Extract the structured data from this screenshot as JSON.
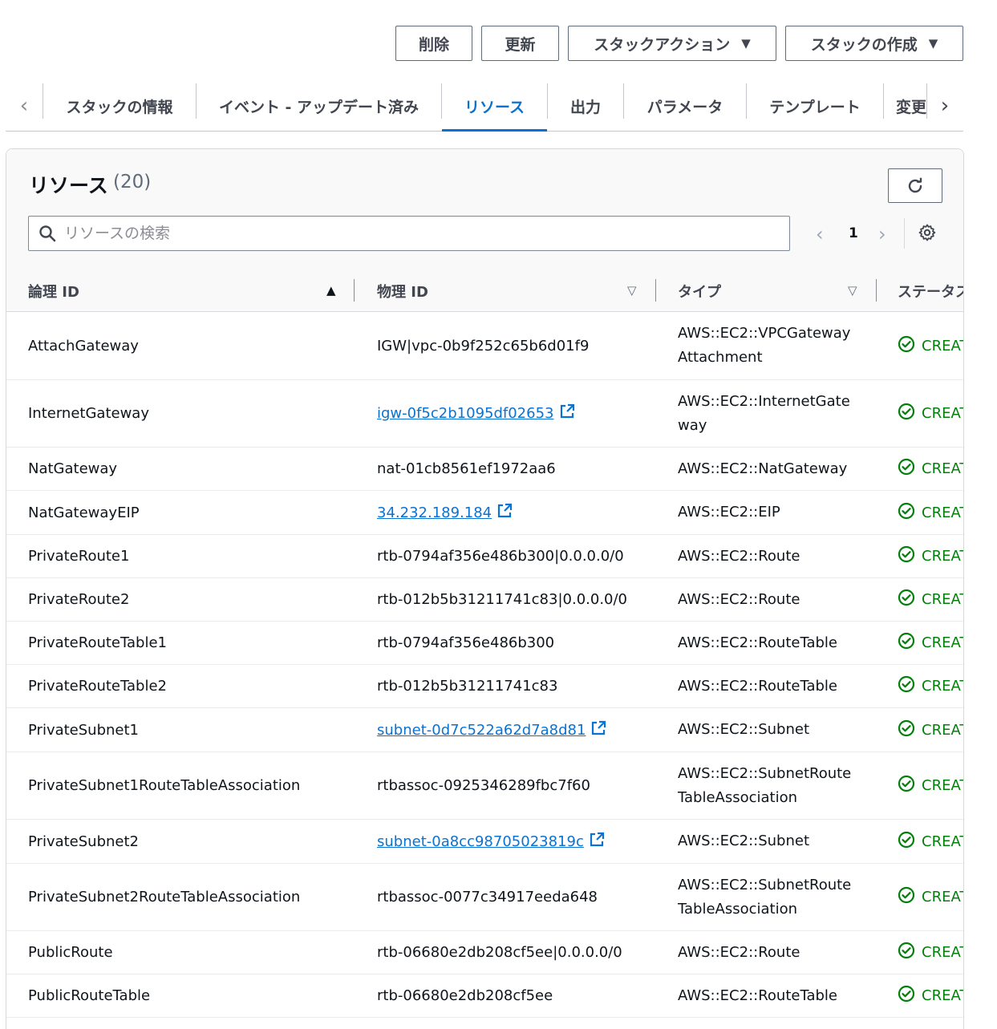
{
  "actions": {
    "delete": "削除",
    "update": "更新",
    "stack_actions": "スタックアクション",
    "create_stack": "スタックの作成"
  },
  "tabs": [
    {
      "label": "スタックの情報"
    },
    {
      "label": "イベント - アップデート済み"
    },
    {
      "label": "リソース"
    },
    {
      "label": "出力"
    },
    {
      "label": "パラメータ"
    },
    {
      "label": "テンプレート"
    },
    {
      "label": "変更"
    }
  ],
  "active_tab": "リソース",
  "panel": {
    "title": "リソース",
    "count": "(20)",
    "search_placeholder": "リソースの検索",
    "search_value": "",
    "page": "1"
  },
  "columns": {
    "logical_id": "論理 ID",
    "physical_id": "物理 ID",
    "type": "タイプ",
    "status": "ステータス"
  },
  "rows": [
    {
      "logical": "AttachGateway",
      "physical": "IGW|vpc-0b9f252c65b6d01f9",
      "link": false,
      "type": "AWS::EC2::VPCGatewayAttachment",
      "status": "CREATE_COMPLETE"
    },
    {
      "logical": "InternetGateway",
      "physical": "igw-0f5c2b1095df02653",
      "link": true,
      "type": "AWS::EC2::InternetGateway",
      "status": "CREATE_COMPLETE"
    },
    {
      "logical": "NatGateway",
      "physical": "nat-01cb8561ef1972aa6",
      "link": false,
      "type": "AWS::EC2::NatGateway",
      "status": "CREATE_COMPLETE"
    },
    {
      "logical": "NatGatewayEIP",
      "physical": "34.232.189.184",
      "link": true,
      "type": "AWS::EC2::EIP",
      "status": "CREATE_COMPLETE"
    },
    {
      "logical": "PrivateRoute1",
      "physical": "rtb-0794af356e486b300|0.0.0.0/0",
      "link": false,
      "type": "AWS::EC2::Route",
      "status": "CREATE_COMPLETE"
    },
    {
      "logical": "PrivateRoute2",
      "physical": "rtb-012b5b31211741c83|0.0.0.0/0",
      "link": false,
      "type": "AWS::EC2::Route",
      "status": "CREATE_COMPLETE"
    },
    {
      "logical": "PrivateRouteTable1",
      "physical": "rtb-0794af356e486b300",
      "link": false,
      "type": "AWS::EC2::RouteTable",
      "status": "CREATE_COMPLETE"
    },
    {
      "logical": "PrivateRouteTable2",
      "physical": "rtb-012b5b31211741c83",
      "link": false,
      "type": "AWS::EC2::RouteTable",
      "status": "CREATE_COMPLETE"
    },
    {
      "logical": "PrivateSubnet1",
      "physical": "subnet-0d7c522a62d7a8d81",
      "link": true,
      "type": "AWS::EC2::Subnet",
      "status": "CREATE_COMPLETE"
    },
    {
      "logical": "PrivateSubnet1RouteTableAssociation",
      "physical": "rtbassoc-0925346289fbc7f60",
      "link": false,
      "type": "AWS::EC2::SubnetRouteTableAssociation",
      "status": "CREATE_COMPLETE"
    },
    {
      "logical": "PrivateSubnet2",
      "physical": "subnet-0a8cc98705023819c",
      "link": true,
      "type": "AWS::EC2::Subnet",
      "status": "CREATE_COMPLETE"
    },
    {
      "logical": "PrivateSubnet2RouteTableAssociation",
      "physical": "rtbassoc-0077c34917eeda648",
      "link": false,
      "type": "AWS::EC2::SubnetRouteTableAssociation",
      "status": "CREATE_COMPLETE"
    },
    {
      "logical": "PublicRoute",
      "physical": "rtb-06680e2db208cf5ee|0.0.0.0/0",
      "link": false,
      "type": "AWS::EC2::Route",
      "status": "CREATE_COMPLETE"
    },
    {
      "logical": "PublicRouteTable",
      "physical": "rtb-06680e2db208cf5ee",
      "link": false,
      "type": "AWS::EC2::RouteTable",
      "status": "CREATE_COMPLETE"
    }
  ],
  "colors": {
    "accent": "#0972d3",
    "success": "#037f0c"
  }
}
